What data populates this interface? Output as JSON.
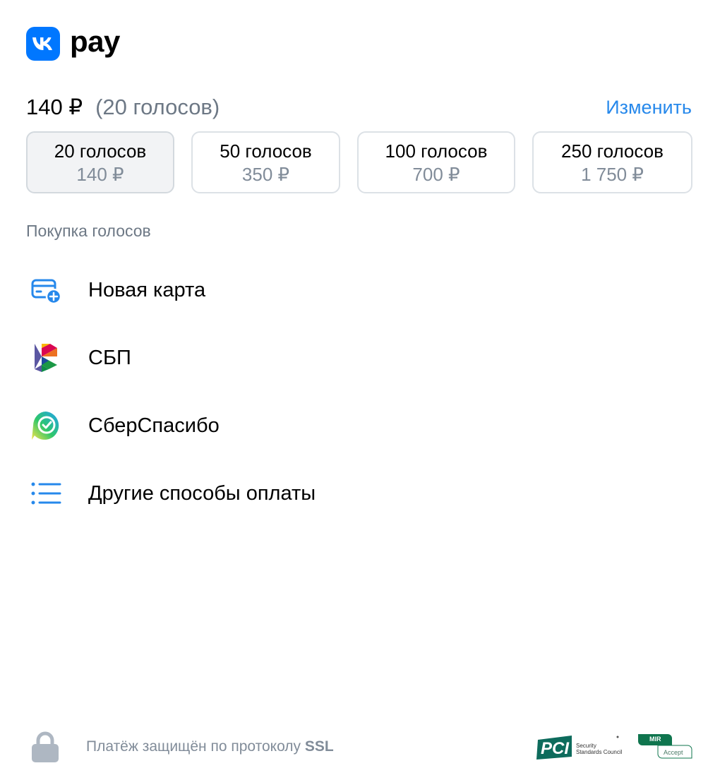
{
  "brand": {
    "logo_text": "pay",
    "color": "#0077ff"
  },
  "summary": {
    "price": "140 ₽",
    "votes": "(20 голосов)",
    "change_label": "Изменить"
  },
  "options": [
    {
      "title": "20 голосов",
      "price": "140 ₽",
      "selected": true
    },
    {
      "title": "50 голосов",
      "price": "350 ₽",
      "selected": false
    },
    {
      "title": "100 голосов",
      "price": "700 ₽",
      "selected": false
    },
    {
      "title": "250 голосов",
      "price": "1 750 ₽",
      "selected": false
    }
  ],
  "section_title": "Покупка голосов",
  "methods": [
    {
      "label": "Новая карта",
      "icon": "new-card-icon"
    },
    {
      "label": "СБП",
      "icon": "sbp-icon"
    },
    {
      "label": "СберСпасибо",
      "icon": "sberspasibo-icon"
    },
    {
      "label": "Другие способы оплаты",
      "icon": "list-icon"
    }
  ],
  "footer": {
    "secure_text": "Платёж защищён по протоколу",
    "secure_protocol": "SSL",
    "pci_line1": "Security",
    "pci_line2": "Standards Council",
    "mir_label": "MIR",
    "mir_accept": "Accept"
  },
  "colors": {
    "accent": "#2688eb",
    "secondary_text": "#6d7885"
  }
}
